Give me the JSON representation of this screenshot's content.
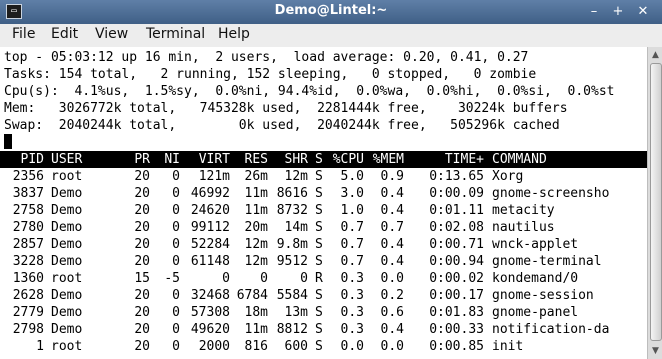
{
  "window": {
    "title": "Demo@Lintel:~",
    "app_icon_glyph": "▭",
    "buttons": {
      "minimize": "–",
      "maximize": "+",
      "close": "✕"
    }
  },
  "menu": [
    "File",
    "Edit",
    "View",
    "Terminal",
    "Help"
  ],
  "summary": [
    "top - 05:03:12 up 16 min,  2 users,  load average: 0.20, 0.41, 0.27",
    "Tasks: 154 total,   2 running, 152 sleeping,   0 stopped,   0 zombie",
    "Cpu(s):  4.1%us,  1.5%sy,  0.0%ni, 94.4%id,  0.0%wa,  0.0%hi,  0.0%si,  0.0%st",
    "Mem:   3026772k total,   745328k used,  2281444k free,    30224k buffers",
    "Swap:  2040244k total,        0k used,  2040244k free,   505296k cached"
  ],
  "columns": [
    "PID",
    "USER",
    "PR",
    "NI",
    "VIRT",
    "RES",
    "SHR",
    "S",
    "%CPU",
    "%MEM",
    "TIME+",
    "COMMAND"
  ],
  "processes": [
    [
      "2356",
      "root",
      "20",
      "0",
      "121m",
      "26m",
      "12m",
      "S",
      "5.0",
      "0.9",
      "0:13.65",
      "Xorg"
    ],
    [
      "3837",
      "Demo",
      "20",
      "0",
      "46992",
      "11m",
      "8616",
      "S",
      "3.0",
      "0.4",
      "0:00.09",
      "gnome-screensho"
    ],
    [
      "2758",
      "Demo",
      "20",
      "0",
      "24620",
      "11m",
      "8732",
      "S",
      "1.0",
      "0.4",
      "0:01.11",
      "metacity"
    ],
    [
      "2780",
      "Demo",
      "20",
      "0",
      "99112",
      "20m",
      "14m",
      "S",
      "0.7",
      "0.7",
      "0:02.08",
      "nautilus"
    ],
    [
      "2857",
      "Demo",
      "20",
      "0",
      "52284",
      "12m",
      "9.8m",
      "S",
      "0.7",
      "0.4",
      "0:00.71",
      "wnck-applet"
    ],
    [
      "3228",
      "Demo",
      "20",
      "0",
      "61148",
      "12m",
      "9512",
      "S",
      "0.7",
      "0.4",
      "0:00.94",
      "gnome-terminal"
    ],
    [
      "1360",
      "root",
      "15",
      "-5",
      "0",
      "0",
      "0",
      "R",
      "0.3",
      "0.0",
      "0:00.02",
      "kondemand/0"
    ],
    [
      "2628",
      "Demo",
      "20",
      "0",
      "32468",
      "6784",
      "5584",
      "S",
      "0.3",
      "0.2",
      "0:00.17",
      "gnome-session"
    ],
    [
      "2779",
      "Demo",
      "20",
      "0",
      "57308",
      "18m",
      "13m",
      "S",
      "0.3",
      "0.6",
      "0:01.83",
      "gnome-panel"
    ],
    [
      "2798",
      "Demo",
      "20",
      "0",
      "49620",
      "11m",
      "8812",
      "S",
      "0.3",
      "0.4",
      "0:00.33",
      "notification-da"
    ],
    [
      "1",
      "root",
      "20",
      "0",
      "2000",
      "816",
      "600",
      "S",
      "0.0",
      "0.0",
      "0:00.85",
      "init"
    ]
  ],
  "icons": {
    "app": "terminal-icon",
    "scroll_up": "scroll-up-arrow-icon",
    "scroll_down": "scroll-down-arrow-icon",
    "cursor": "mouse-pointer-icon"
  }
}
